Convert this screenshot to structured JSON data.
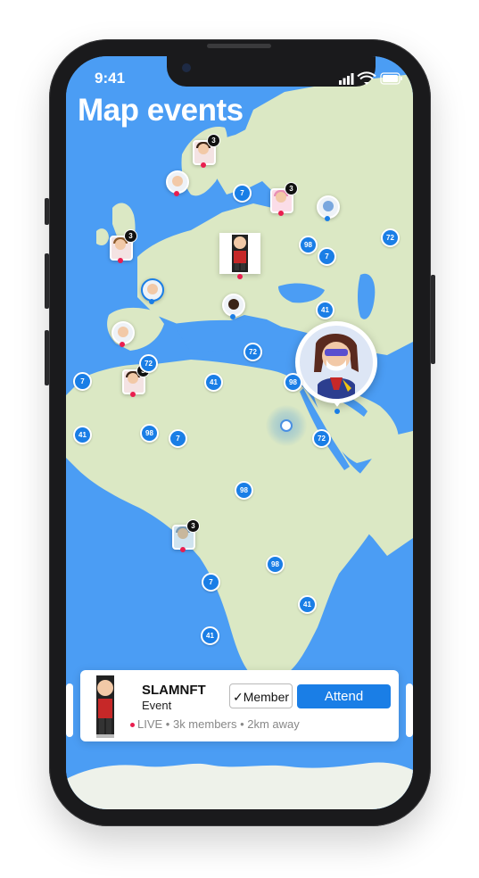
{
  "status_bar": {
    "time": "9:41"
  },
  "page": {
    "title": "Map events"
  },
  "colors": {
    "ocean": "#4b9df4",
    "land": "#dbe8c4",
    "accent": "#1a7ee6",
    "live": "#e91e4f"
  },
  "map": {
    "clusters": [
      "7",
      "98",
      "7",
      "72",
      "41",
      "72",
      "98",
      "41",
      "7",
      "41",
      "98",
      "7",
      "72",
      "98",
      "72",
      "7",
      "98",
      "41"
    ],
    "pin_badges": [
      "3",
      "3",
      "3",
      "3",
      "3"
    ]
  },
  "card": {
    "name": "SLAMNFT",
    "type": "Event",
    "live_label": "LIVE",
    "meta": " • 3k members • 2km away",
    "member_button": "Member",
    "attend_button": "Attend"
  },
  "icons": [
    "signal-icon",
    "wifi-icon",
    "battery-icon",
    "check-icon",
    "location-icon"
  ]
}
